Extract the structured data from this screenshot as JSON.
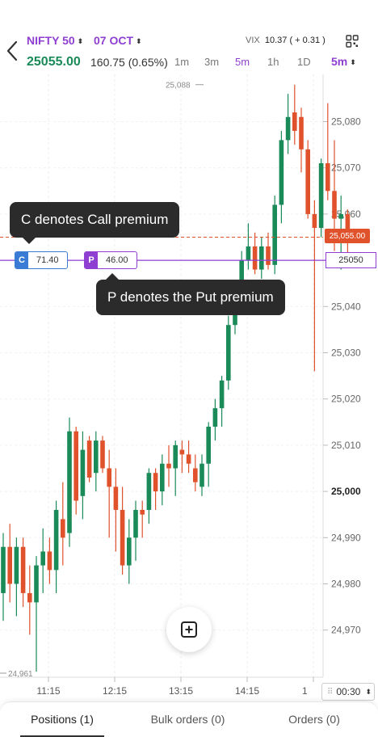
{
  "header": {
    "symbol": "NIFTY 50",
    "expiry": "07 OCT",
    "vix_label": "VIX",
    "vix_value": "10.37",
    "vix_change": "( + 0.31 )",
    "price": "25055.00",
    "change": "160.75 (0.65%)",
    "timeframes": [
      "1m",
      "3m",
      "5m",
      "1h",
      "1D"
    ],
    "active_timeframe": "5m",
    "selected_timeframe": "5m",
    "updown_glyph": "⬍"
  },
  "chart": {
    "price_labels": [
      "25,080",
      "25,070",
      "25,060",
      "25,040",
      "25,030",
      "25,020",
      "25,010",
      "25,000",
      "24,990",
      "24,980",
      "24,970"
    ],
    "time_labels": [
      "11:15",
      "12:15",
      "13:15",
      "14:15",
      "1"
    ],
    "high_label": "25,088",
    "low_label": "24,961",
    "ltp_tag": "25,055.00",
    "strike_tag": "25050",
    "colors": {
      "up": "#1a8a58",
      "down": "#e0522c",
      "strike_line": "#8e3fd1",
      "ltp_line": "#e0522c"
    }
  },
  "chart_data": {
    "type": "candlestick",
    "yticks": [
      25080,
      25070,
      25060,
      25040,
      25030,
      25020,
      25010,
      25000,
      24990,
      24980,
      24970
    ],
    "xticks": [
      "11:15",
      "12:15",
      "13:15",
      "14:15"
    ],
    "ylim": [
      24958,
      25090
    ],
    "ltp": 25055.0,
    "strike": 25050,
    "high": 25088,
    "low": 24961,
    "candles": [
      {
        "o": 24978,
        "h": 24991,
        "l": 24972,
        "c": 24988
      },
      {
        "o": 24988,
        "h": 24993,
        "l": 24976,
        "c": 24980
      },
      {
        "o": 24980,
        "h": 24990,
        "l": 24973,
        "c": 24988
      },
      {
        "o": 24988,
        "h": 24990,
        "l": 24975,
        "c": 24978
      },
      {
        "o": 24978,
        "h": 24984,
        "l": 24969,
        "c": 24976
      },
      {
        "o": 24976,
        "h": 24986,
        "l": 24961,
        "c": 24984
      },
      {
        "o": 24984,
        "h": 24992,
        "l": 24978,
        "c": 24987
      },
      {
        "o": 24987,
        "h": 24990,
        "l": 24980,
        "c": 24983
      },
      {
        "o": 24983,
        "h": 24998,
        "l": 24978,
        "c": 24996
      },
      {
        "o": 24994,
        "h": 25002,
        "l": 24984,
        "c": 24990
      },
      {
        "o": 24991,
        "h": 25016,
        "l": 24988,
        "c": 25013
      },
      {
        "o": 25013,
        "h": 25014,
        "l": 24995,
        "c": 24998
      },
      {
        "o": 24999,
        "h": 25013,
        "l": 24994,
        "c": 25009
      },
      {
        "o": 25011,
        "h": 25012,
        "l": 25002,
        "c": 25003
      },
      {
        "o": 25004,
        "h": 25013,
        "l": 25000,
        "c": 25011
      },
      {
        "o": 25011,
        "h": 25012,
        "l": 25004,
        "c": 25005
      },
      {
        "o": 25005,
        "h": 25009,
        "l": 24990,
        "c": 25001
      },
      {
        "o": 25001,
        "h": 25005,
        "l": 24987,
        "c": 24996
      },
      {
        "o": 24996,
        "h": 25001,
        "l": 24982,
        "c": 24984
      },
      {
        "o": 24984,
        "h": 24994,
        "l": 24980,
        "c": 24990
      },
      {
        "o": 24990,
        "h": 24998,
        "l": 24985,
        "c": 24996
      },
      {
        "o": 24996,
        "h": 24998,
        "l": 24990,
        "c": 24995
      },
      {
        "o": 24996,
        "h": 25005,
        "l": 24993,
        "c": 25004
      },
      {
        "o": 25004,
        "h": 25005,
        "l": 24996,
        "c": 25000
      },
      {
        "o": 25000,
        "h": 25008,
        "l": 24997,
        "c": 25006
      },
      {
        "o": 25006,
        "h": 25010,
        "l": 25001,
        "c": 25005
      },
      {
        "o": 25005,
        "h": 25011,
        "l": 24999,
        "c": 25010
      },
      {
        "o": 25009,
        "h": 25011,
        "l": 25004,
        "c": 25008
      },
      {
        "o": 25008,
        "h": 25011,
        "l": 25004,
        "c": 25006
      },
      {
        "o": 25005,
        "h": 25008,
        "l": 25000,
        "c": 25002
      },
      {
        "o": 25001,
        "h": 25008,
        "l": 24999,
        "c": 25006
      },
      {
        "o": 25006,
        "h": 25015,
        "l": 25001,
        "c": 25014
      },
      {
        "o": 25014,
        "h": 25020,
        "l": 25011,
        "c": 25018
      },
      {
        "o": 25018,
        "h": 25025,
        "l": 25014,
        "c": 25024
      },
      {
        "o": 25024,
        "h": 25038,
        "l": 25022,
        "c": 25036
      },
      {
        "o": 25036,
        "h": 25044,
        "l": 25034,
        "c": 25041
      },
      {
        "o": 25041,
        "h": 25052,
        "l": 25039,
        "c": 25050
      },
      {
        "o": 25050,
        "h": 25058,
        "l": 25048,
        "c": 25053
      },
      {
        "o": 25053,
        "h": 25056,
        "l": 25047,
        "c": 25048
      },
      {
        "o": 25048,
        "h": 25055,
        "l": 25046,
        "c": 25053
      },
      {
        "o": 25053,
        "h": 25056,
        "l": 25048,
        "c": 25049
      },
      {
        "o": 25049,
        "h": 25064,
        "l": 25047,
        "c": 25062
      },
      {
        "o": 25062,
        "h": 25078,
        "l": 25058,
        "c": 25076
      },
      {
        "o": 25076,
        "h": 25086,
        "l": 25073,
        "c": 25081
      },
      {
        "o": 25082,
        "h": 25088,
        "l": 25075,
        "c": 25078
      },
      {
        "o": 25081,
        "h": 25083,
        "l": 25069,
        "c": 25074
      },
      {
        "o": 25074,
        "h": 25076,
        "l": 25059,
        "c": 25060
      },
      {
        "o": 25060,
        "h": 25063,
        "l": 25026,
        "c": 25057
      },
      {
        "o": 25057,
        "h": 25072,
        "l": 25055,
        "c": 25071
      },
      {
        "o": 25071,
        "h": 25084,
        "l": 25063,
        "c": 25065
      },
      {
        "o": 25065,
        "h": 25076,
        "l": 25052,
        "c": 25059
      },
      {
        "o": 25059,
        "h": 25064,
        "l": 25048,
        "c": 25060
      },
      {
        "o": 25060,
        "h": 25061,
        "l": 25050,
        "c": 25055
      }
    ]
  },
  "overlays": {
    "call_tip": "C denotes Call premium",
    "put_tip": "P denotes the Put premium",
    "call_letter": "C",
    "call_value": "71.40",
    "put_letter": "P",
    "put_value": "46.00"
  },
  "interval": {
    "grip": "⠿",
    "value": "00:30",
    "updown": "⬍"
  },
  "tabs": [
    {
      "label": "Positions (1)"
    },
    {
      "label": "Bulk orders (0)"
    },
    {
      "label": "Orders (0)"
    }
  ]
}
